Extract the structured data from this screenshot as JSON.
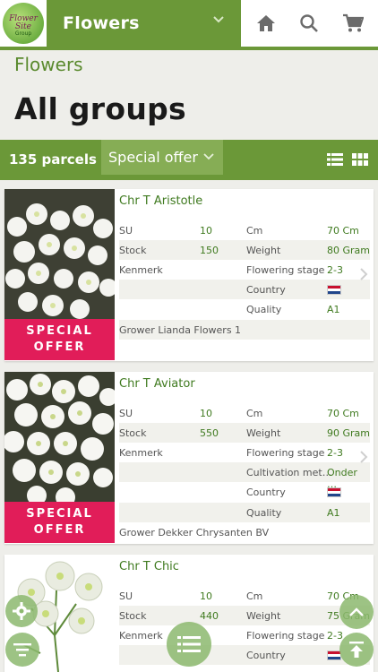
{
  "header": {
    "logo_alt": "Flower Site",
    "logo_line1": "Flower Site",
    "logo_line2": "Group",
    "category": "Flowers",
    "icons": [
      "home-icon",
      "search-icon",
      "cart-icon"
    ]
  },
  "breadcrumb": "Flowers",
  "page_title": "All groups",
  "filter": {
    "parcels": "135 parcels",
    "offer_select": "Special offer",
    "view_icons": [
      "list-view-icon",
      "grid-view-icon"
    ]
  },
  "colors": {
    "brand_green": "#6b9838",
    "offer_pink": "#e11d59",
    "value_green": "#3f7a1f"
  },
  "badge": {
    "line1": "SPECIAL",
    "line2": "OFFER"
  },
  "products": [
    {
      "name": "Chr T Aristotle",
      "rows": [
        {
          "l1": "SU",
          "v1": "10",
          "l2": "Cm",
          "v2": "70 Cm"
        },
        {
          "l1": "Stock",
          "v1": "150",
          "l2": "Weight",
          "v2": "80 Gram"
        },
        {
          "l1": "Kenmerk",
          "v1": "",
          "l2": "Flowering stage",
          "v2": "2-3"
        },
        {
          "l1": "",
          "v1": "",
          "l2": "Country",
          "v2": "flag-nl"
        },
        {
          "l1": "",
          "v1": "",
          "l2": "Quality",
          "v2": "A1"
        }
      ],
      "grower": "Grower Lianda Flowers 1"
    },
    {
      "name": "Chr T Aviator",
      "rows": [
        {
          "l1": "SU",
          "v1": "10",
          "l2": "Cm",
          "v2": "70 Cm"
        },
        {
          "l1": "Stock",
          "v1": "550",
          "l2": "Weight",
          "v2": "90 Gram"
        },
        {
          "l1": "Kenmerk",
          "v1": "",
          "l2": "Flowering stage",
          "v2": "2-3"
        },
        {
          "l1": "",
          "v1": "",
          "l2": "Cultivation met…",
          "v2": "Onder …"
        },
        {
          "l1": "",
          "v1": "",
          "l2": "Country",
          "v2": "flag-nl"
        },
        {
          "l1": "",
          "v1": "",
          "l2": "Quality",
          "v2": "A1"
        }
      ],
      "grower": "Grower Dekker Chrysanten BV"
    },
    {
      "name": "Chr T Chic",
      "rows": [
        {
          "l1": "SU",
          "v1": "10",
          "l2": "Cm",
          "v2": "70 Cm"
        },
        {
          "l1": "Stock",
          "v1": "440",
          "l2": "Weight",
          "v2": "75 Gram"
        },
        {
          "l1": "Kenmerk",
          "v1": "",
          "l2": "Flowering stage",
          "v2": "2-3"
        },
        {
          "l1": "",
          "v1": "",
          "l2": "Country",
          "v2": "flag-nl"
        }
      ]
    }
  ],
  "fabs": [
    "settings-icon",
    "filter-icon",
    "list-icon",
    "scroll-up-icon",
    "scroll-top-icon"
  ]
}
